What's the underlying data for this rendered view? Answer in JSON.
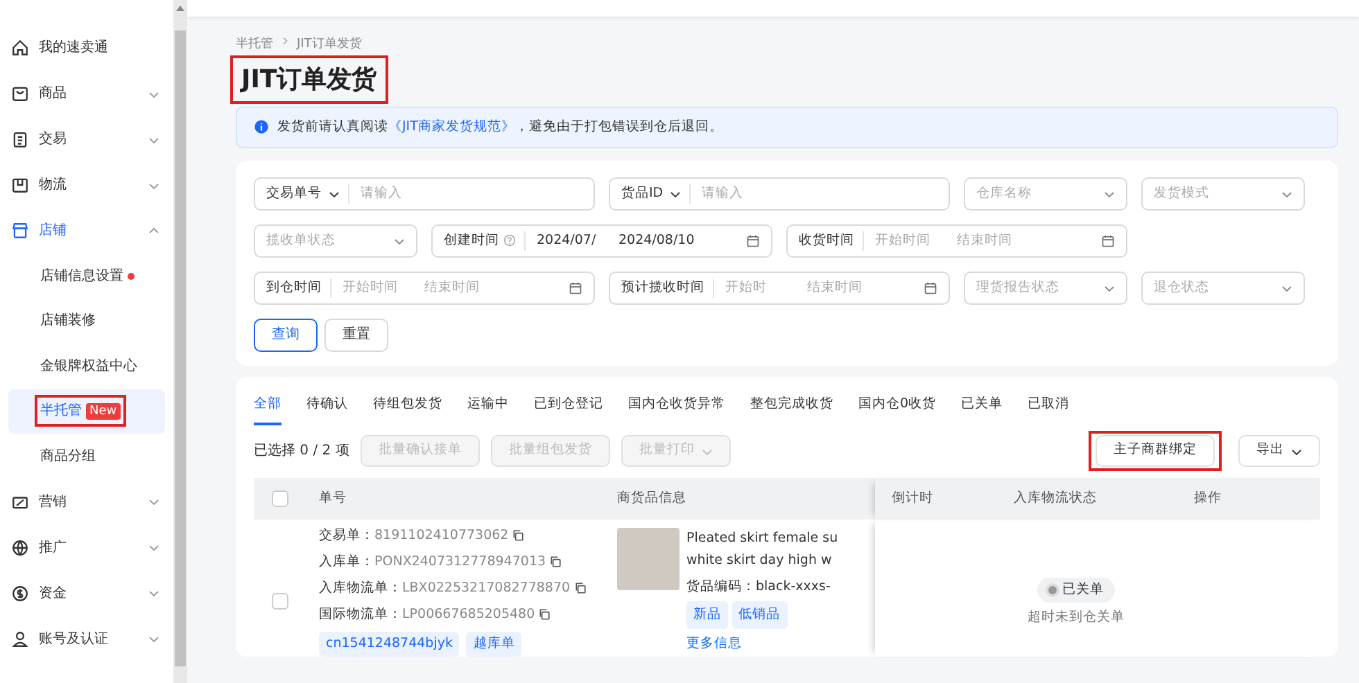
{
  "sidebar": {
    "items": [
      {
        "label": "我的速卖通",
        "selected": false
      },
      {
        "label": "商品",
        "expanded": false,
        "selected": false
      },
      {
        "label": "交易",
        "expanded": false,
        "selected": false
      },
      {
        "label": "物流",
        "expanded": false,
        "selected": false
      },
      {
        "label": "店铺",
        "expanded": true,
        "selected": true,
        "children": [
          {
            "label": "店铺信息设置",
            "selected": false,
            "dot": true
          },
          {
            "label": "店铺装修",
            "selected": false
          },
          {
            "label": "金银牌权益中心",
            "selected": false
          },
          {
            "label": "半托管",
            "selected": true,
            "badge": "New",
            "highlighted": true
          },
          {
            "label": "商品分组",
            "selected": false
          }
        ]
      },
      {
        "label": "营销",
        "expanded": false,
        "selected": false
      },
      {
        "label": "推广",
        "expanded": false,
        "selected": false
      },
      {
        "label": "资金",
        "expanded": false,
        "selected": false
      },
      {
        "label": "账号及认证",
        "expanded": false,
        "selected": false
      }
    ]
  },
  "breadcrumb": [
    "半托管",
    "JIT订单发货"
  ],
  "page_title": {
    "text": "JIT订单发货",
    "highlighted": true
  },
  "notice": {
    "before": "发货前请认真阅读",
    "link": "《JIT商家发货规范》",
    "after": "，避免由于打包错误到仓后退回。"
  },
  "filters": [
    [
      {
        "kind": "select-input",
        "label": "交易单号",
        "placeholder": "请输入"
      },
      {
        "kind": "select-input",
        "label": "货品ID",
        "placeholder": "请输入"
      },
      {
        "kind": "select",
        "placeholder": "仓库名称"
      },
      {
        "kind": "select",
        "placeholder": "发货模式"
      }
    ],
    [
      {
        "kind": "select",
        "placeholder": "揽收单状态"
      },
      {
        "kind": "daterange",
        "label": "创建时间",
        "help": true,
        "start": "2024/07/",
        "end": "2024/08/10"
      },
      {
        "kind": "daterange",
        "label": "收货时间",
        "start_placeholder": "开始时间",
        "end_placeholder": "结束时间"
      }
    ],
    [
      {
        "kind": "daterange",
        "label": "到仓时间",
        "start_placeholder": "开始时间",
        "end_placeholder": "结束时间"
      },
      {
        "kind": "daterange",
        "label": "预计揽收时间",
        "start_placeholder": "开始时",
        "end_placeholder": "结束时间"
      },
      {
        "kind": "select",
        "placeholder": "理货报告状态"
      },
      {
        "kind": "select",
        "placeholder": "退仓状态"
      }
    ]
  ],
  "filter_buttons": [
    {
      "label": "查询",
      "primary": true
    },
    {
      "label": "重置",
      "primary": false
    }
  ],
  "tabs": [
    {
      "label": "全部",
      "selected": true
    },
    {
      "label": "待确认",
      "selected": false
    },
    {
      "label": "待组包发货",
      "selected": false
    },
    {
      "label": "运输中",
      "selected": false
    },
    {
      "label": "已到仓登记",
      "selected": false
    },
    {
      "label": "国内仓收货异常",
      "selected": false
    },
    {
      "label": "整包完成收货",
      "selected": false
    },
    {
      "label": "国内仓0收货",
      "selected": false
    },
    {
      "label": "已关单",
      "selected": false
    },
    {
      "label": "已取消",
      "selected": false
    }
  ],
  "selection_count": "已选择 0 / 2 项",
  "batch_buttons": [
    {
      "label": "批量确认接单",
      "disabled": true,
      "caret": false
    },
    {
      "label": "批量组包发货",
      "disabled": true,
      "caret": false
    },
    {
      "label": "批量打印",
      "disabled": true,
      "caret": true
    }
  ],
  "right_buttons": [
    {
      "label": "主子商群绑定",
      "caret": false,
      "highlighted": true
    },
    {
      "label": "导出",
      "caret": true,
      "highlighted": false
    }
  ],
  "table": {
    "columns": [
      "单号",
      "商货品信息",
      "倒计时",
      "入库物流状态",
      "操作"
    ],
    "all_checked": false,
    "rows": [
      {
        "checked": false,
        "numbers": [
          {
            "label": "交易单：",
            "value": "8191102410773062"
          },
          {
            "label": "入库单：",
            "value": "PONX2407312778947013"
          },
          {
            "label": "入库物流单：",
            "value": "LBX02253217082778870"
          },
          {
            "label": "国际物流单：",
            "value": "LP00667685205480"
          }
        ],
        "number_tags": [
          "cn1541248744bjyk",
          "越库单"
        ],
        "product_title": [
          "Pleated skirt female su",
          "white skirt day high w"
        ],
        "product_code_label": "货品编码：",
        "product_code": "black-xxxs-",
        "product_tags": [
          "新品",
          "低销品"
        ],
        "more": "更多信息",
        "status": "已关单",
        "status_note": "超时未到仓关单"
      }
    ]
  }
}
